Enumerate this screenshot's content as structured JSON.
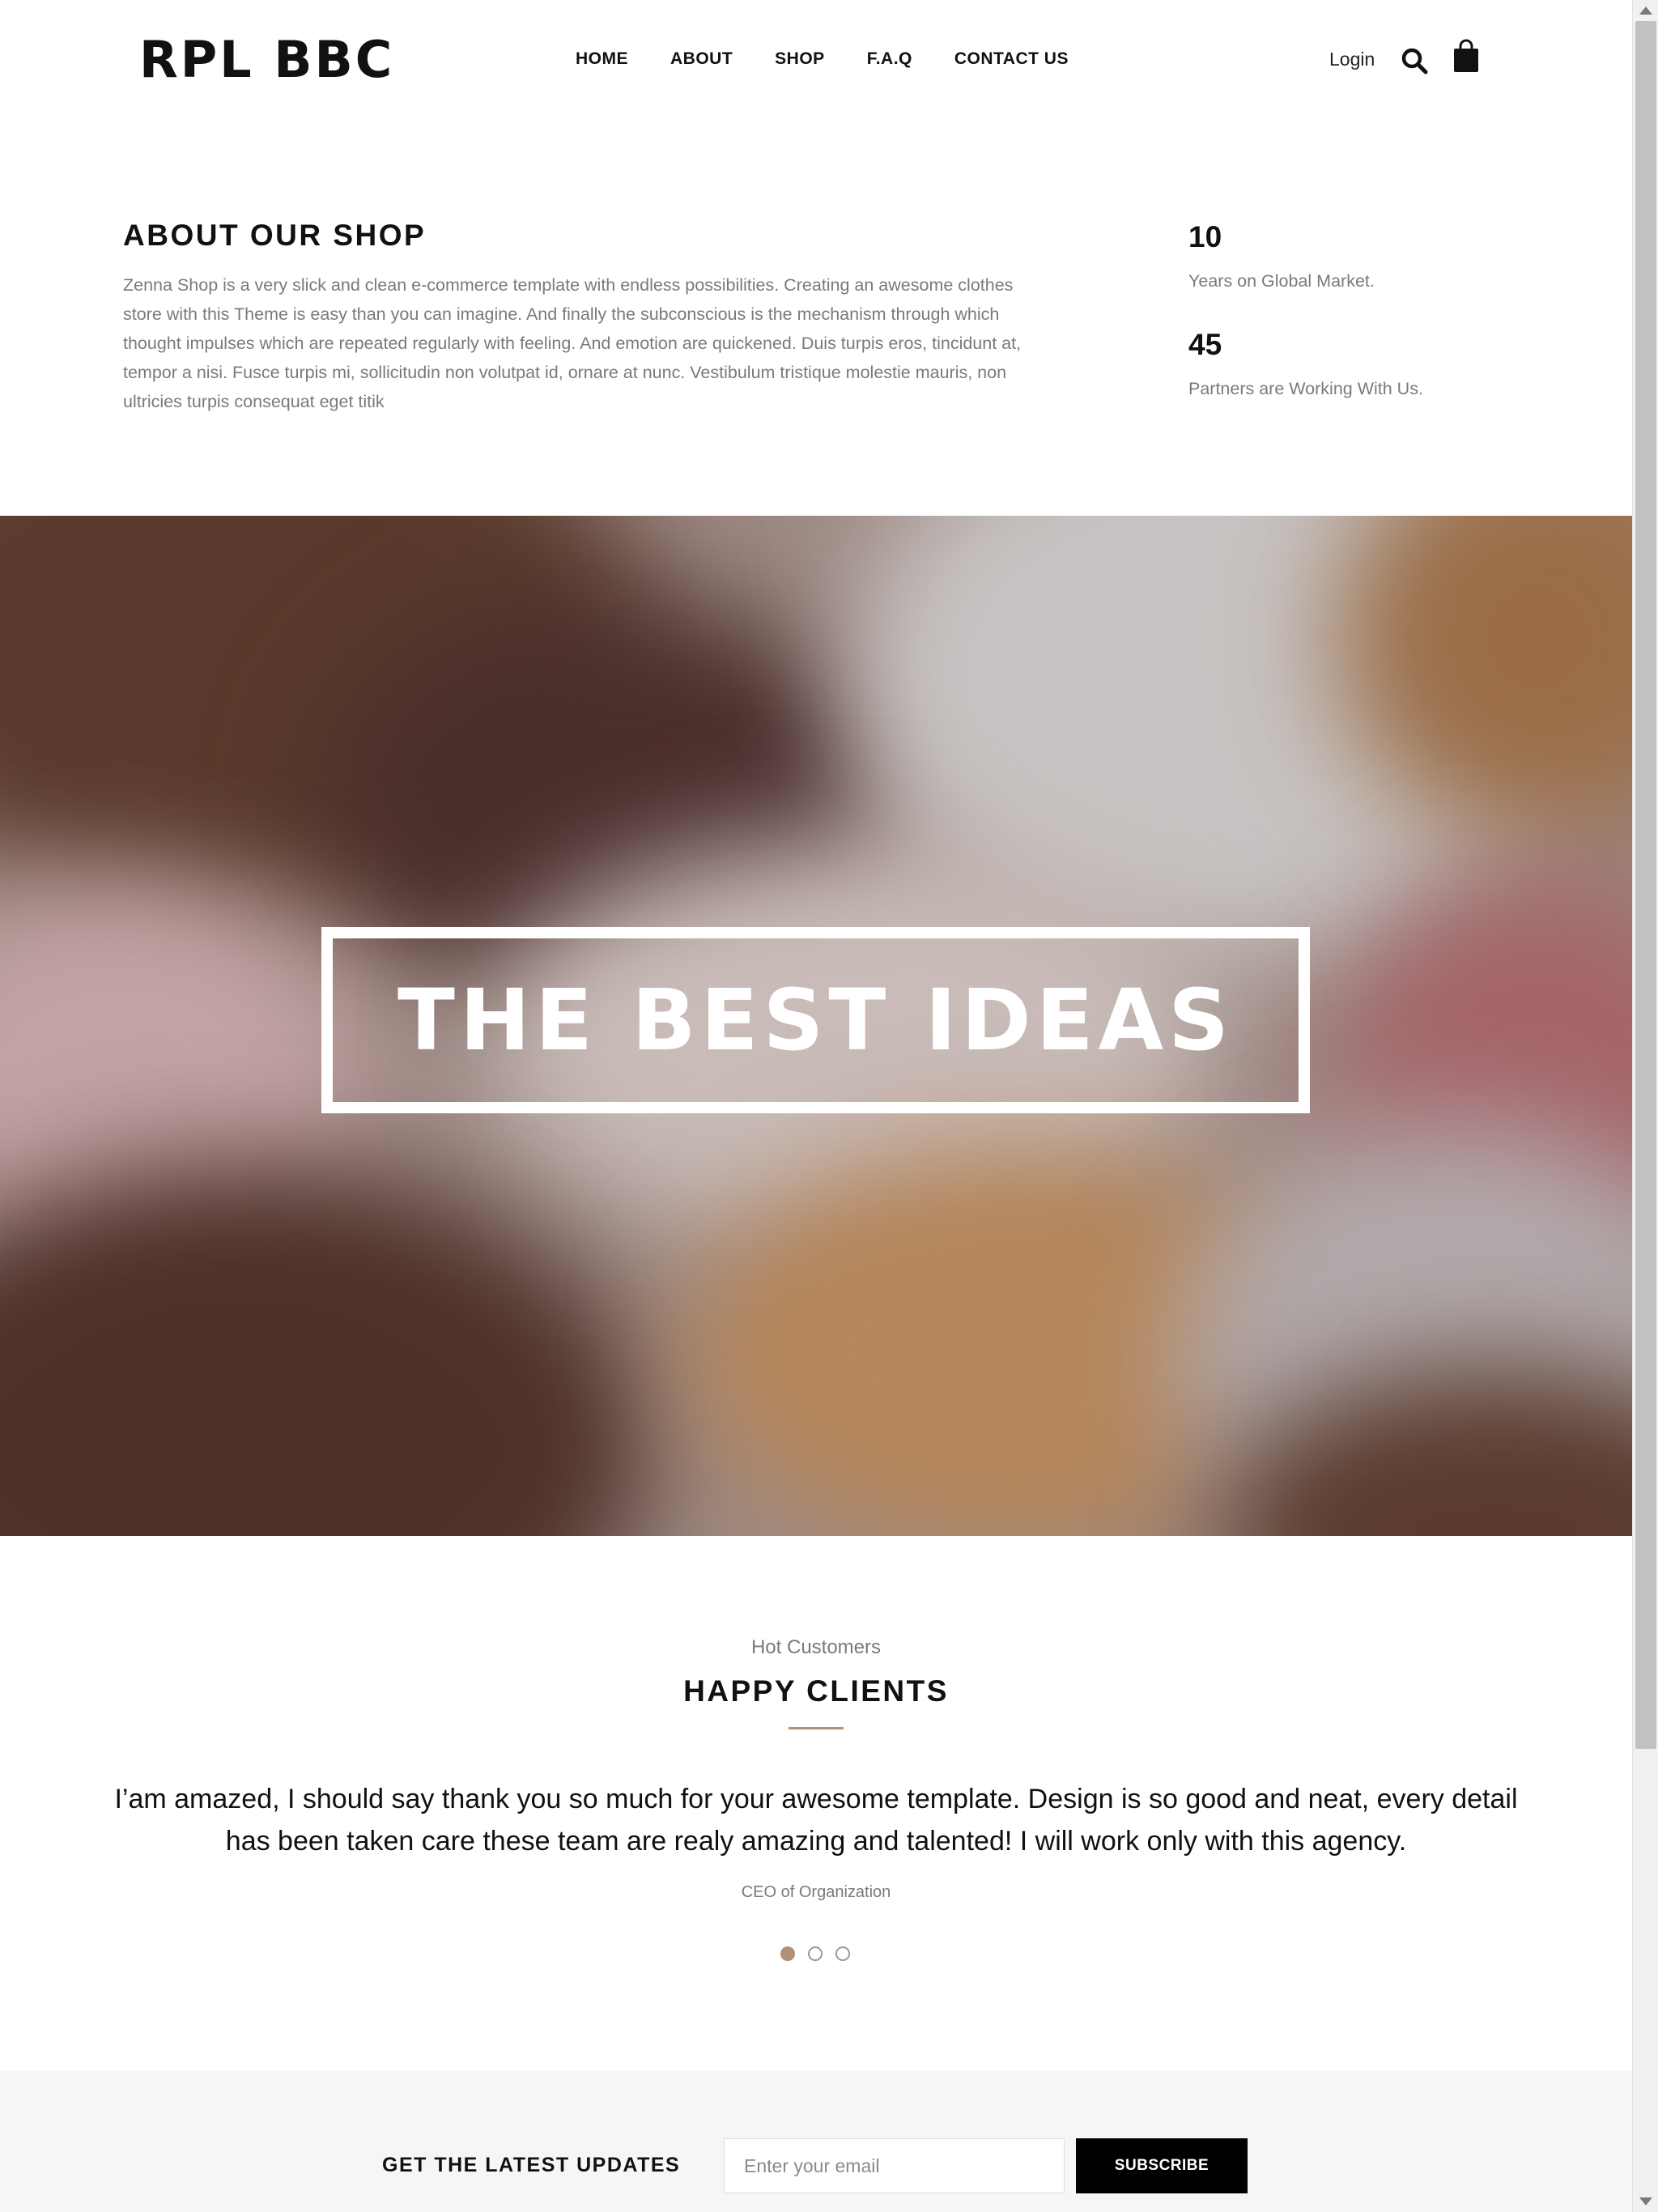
{
  "header": {
    "logo": "RPL BBC",
    "nav": [
      "HOME",
      "ABOUT",
      "SHOP",
      "F.A.Q",
      "CONTACT US"
    ],
    "login": "Login",
    "icons": [
      "search-icon",
      "shopping-bag-icon"
    ]
  },
  "about": {
    "title": "ABOUT OUR SHOP",
    "text": "Zenna Shop is a very slick and clean e-commerce template with endless possibilities. Creating an awesome clothes store with this Theme is easy than you can imagine. And finally the subconscious is the mechanism through which thought impulses which are repeated regularly with feeling. And emotion are quickened. Duis turpis eros, tincidunt at, tempor a nisi. Fusce turpis mi, sollicitudin non volutpat id, ornare at nunc. Vestibulum tristique molestie mauris, non ultricies turpis consequat eget titik",
    "stats": [
      {
        "number": "10",
        "label": "Years on Global Market."
      },
      {
        "number": "45",
        "label": "Partners are Working With Us."
      }
    ]
  },
  "hero": {
    "text": "THE BEST IDEAS"
  },
  "clients": {
    "subtitle": "Hot Customers",
    "title": "HAPPY CLIENTS",
    "quote": "I’am amazed, I should say thank you so much for your awesome template. Design is so good and neat, every detail has been taken care these team are realy amazing and talented! I will work only with this agency.",
    "author": "CEO of Organization",
    "slides_count": 3,
    "active_slide": 1
  },
  "newsletter": {
    "label": "GET THE LATEST UPDATES",
    "placeholder": "Enter your email",
    "button": "SUBSCRIBE"
  },
  "colors": {
    "accent": "#b08f77",
    "text": "#111111",
    "muted": "#7a7a7a",
    "newsletter_bg": "#f5f6f7"
  }
}
